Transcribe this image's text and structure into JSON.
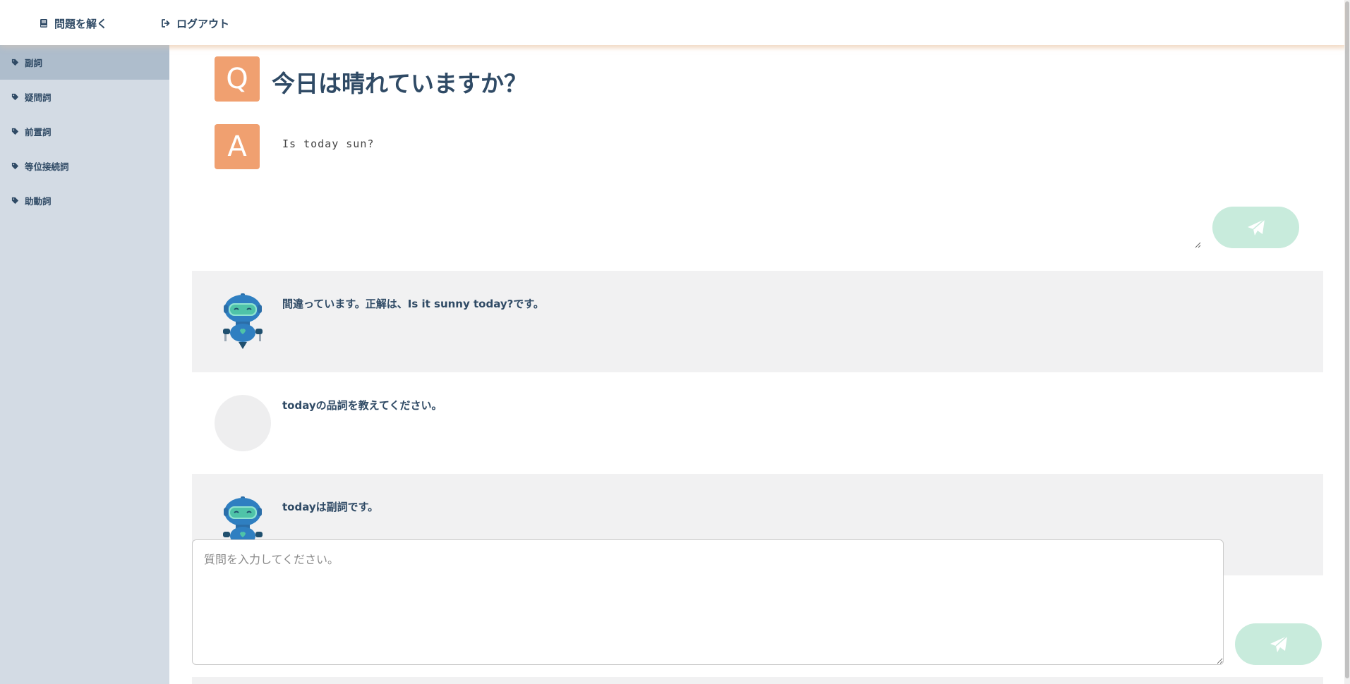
{
  "nav": {
    "solve_label": "問題を解く",
    "logout_label": "ログアウト"
  },
  "sidebar": {
    "items": [
      {
        "label": "副詞",
        "active": true
      },
      {
        "label": "疑問詞",
        "active": false
      },
      {
        "label": "前置詞",
        "active": false
      },
      {
        "label": "等位接続詞",
        "active": false
      },
      {
        "label": "助動詞",
        "active": false
      }
    ]
  },
  "question": {
    "badge": "Q",
    "text": "今日は晴れていますか？"
  },
  "answer": {
    "badge": "A",
    "text": "Is today sun?"
  },
  "chat": {
    "messages": [
      {
        "role": "bot",
        "text": "間違っています。正解は、Is it sunny today?です。"
      },
      {
        "role": "user",
        "text": "todayの品詞を教えてください。"
      },
      {
        "role": "bot",
        "text": "todayは副詞です。"
      }
    ]
  },
  "ask": {
    "placeholder": "質問を入力してください。",
    "value": ""
  },
  "colors": {
    "accent_badge": "#f0a070",
    "send_button": "#c8ebdc",
    "sidebar_bg": "#d3dbe4",
    "sidebar_active": "#aebdcc",
    "text_primary": "#2f4a65",
    "bot_message_bg": "#f1f1f2"
  },
  "icons": {
    "solve": "book-icon",
    "logout": "sign-out-icon",
    "sidebar_item": "tag-icon",
    "send": "paper-plane-icon",
    "bot_avatar": "robot-icon"
  }
}
